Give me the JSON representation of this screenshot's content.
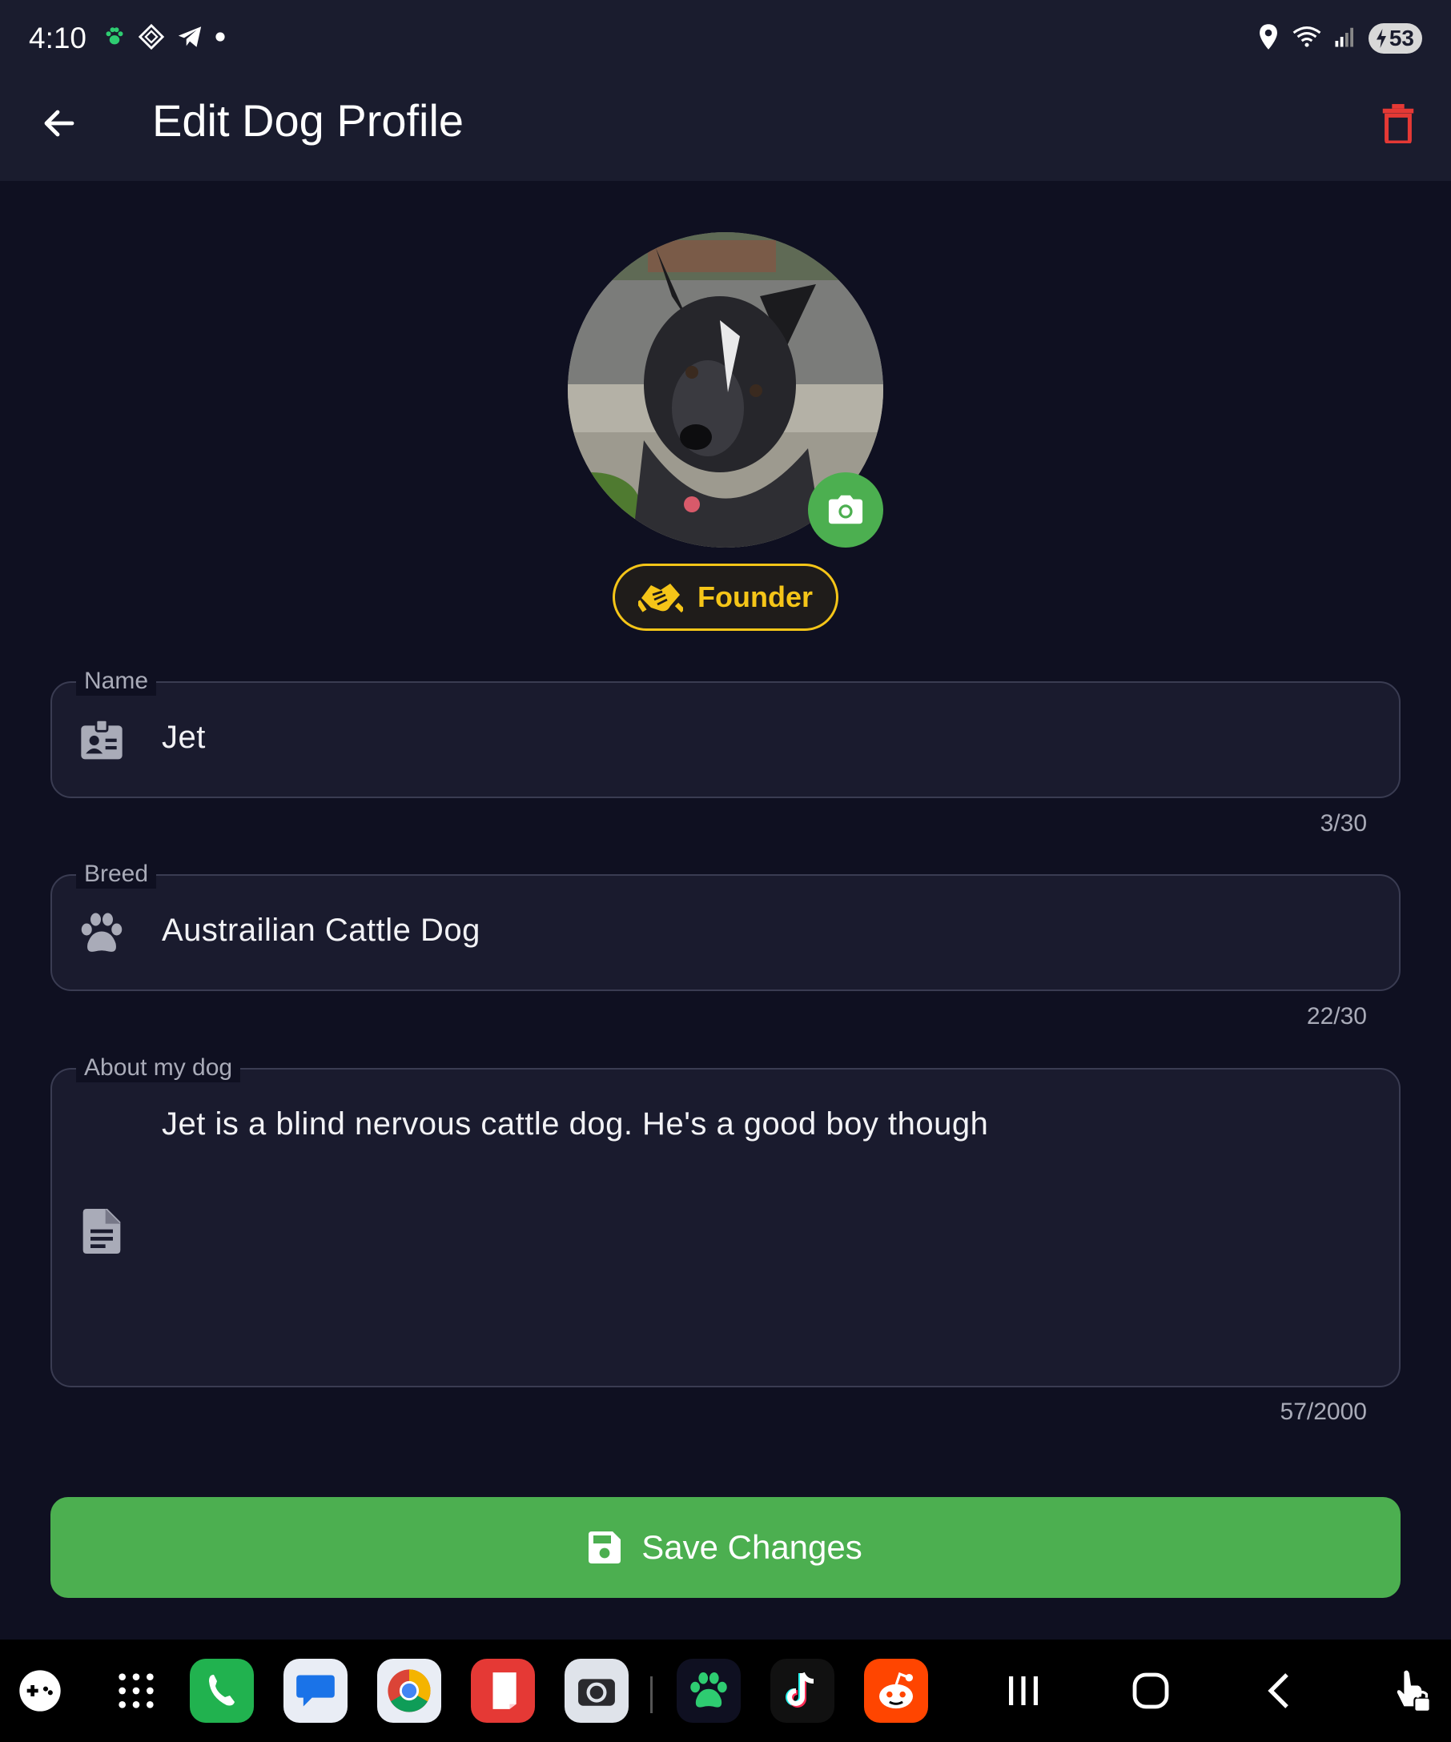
{
  "status_bar": {
    "time": "4:10",
    "battery": "53",
    "icons_left": [
      "paw-icon",
      "diamond-grid-icon",
      "telegram-icon",
      "dot-icon"
    ],
    "icons_right": [
      "location-icon",
      "wifi-icon",
      "signal-icon",
      "battery-icon"
    ]
  },
  "app_bar": {
    "title": "Edit Dog Profile",
    "back_icon": "arrow-left-icon",
    "delete_icon": "trash-icon",
    "delete_color": "#e53935"
  },
  "profile": {
    "camera_icon": "camera-icon",
    "badge_label": "Founder",
    "badge_icon": "handshake-icon",
    "badge_color": "#f5c518"
  },
  "fields": {
    "name": {
      "label": "Name",
      "value": "Jet",
      "counter": "3/30",
      "icon": "id-badge-icon"
    },
    "breed": {
      "label": "Breed",
      "value": "Austrailian Cattle Dog",
      "counter": "22/30",
      "icon": "paw-icon"
    },
    "about": {
      "label": "About my dog",
      "value": "Jet is a blind nervous cattle dog. He's a good boy though",
      "counter": "57/2000",
      "icon": "document-icon"
    }
  },
  "actions": {
    "save_label": "Save Changes",
    "save_icon": "floppy-disk-icon",
    "accent": "#4caf50"
  },
  "taskbar": {
    "items": [
      "game-launcher-icon",
      "app-drawer-icon",
      "phone-icon",
      "messages-icon",
      "chrome-icon",
      "notes-icon",
      "camera-app-icon",
      "paw-app-icon",
      "tiktok-icon",
      "reddit-icon",
      "recents-icon",
      "home-icon",
      "nav-back-icon",
      "touch-lock-icon"
    ]
  }
}
